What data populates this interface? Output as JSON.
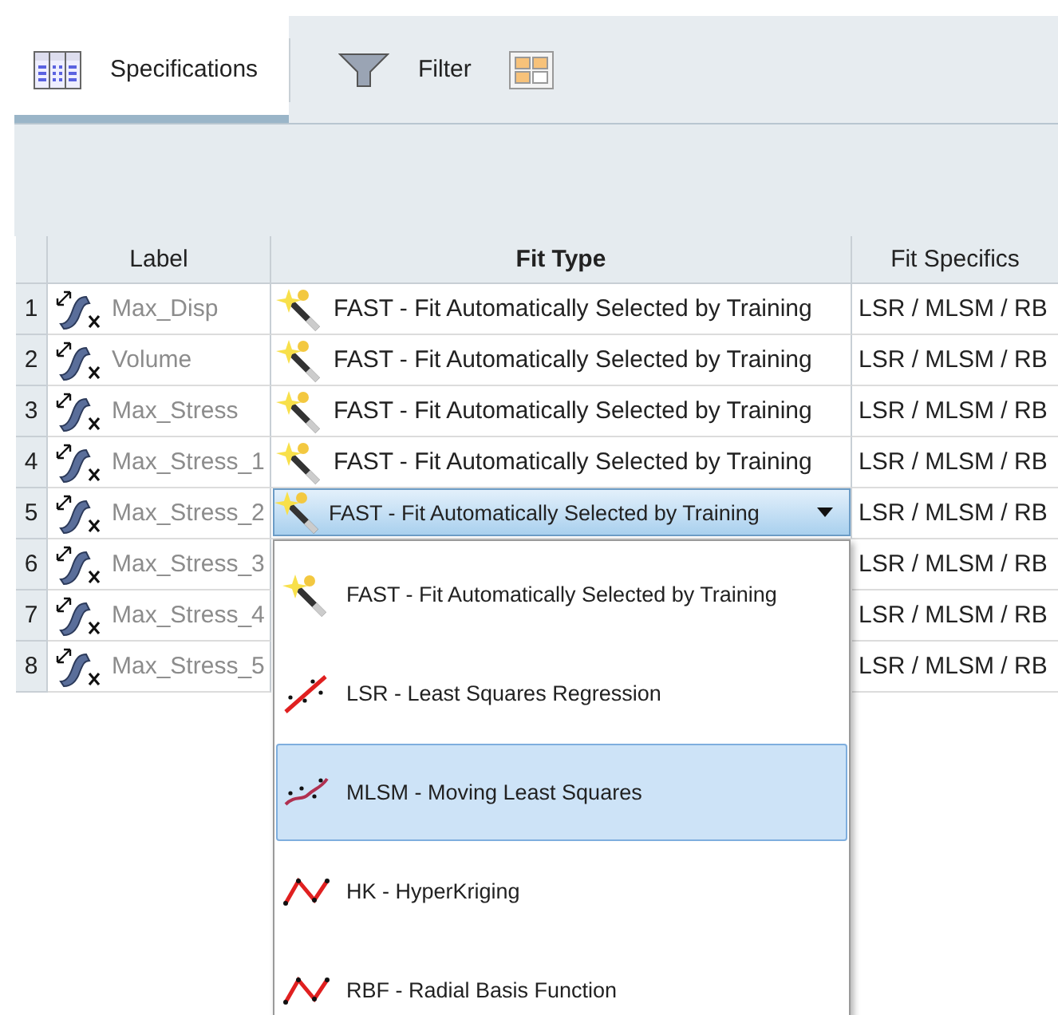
{
  "tabs": [
    {
      "kind": "table",
      "label": "Specifications",
      "selected": true
    },
    {
      "kind": "filter",
      "label": "Filter",
      "selected": false
    }
  ],
  "table": {
    "columns": [
      "Label",
      "Fit Type",
      "Fit Specifics"
    ],
    "rows": [
      {
        "number": "1",
        "label": "Max_Disp",
        "fit_type": "FAST - Fit Automatically Selected by Training",
        "fit_specifics": "LSR / MLSM / RB"
      },
      {
        "number": "2",
        "label": "Volume",
        "fit_type": "FAST - Fit Automatically Selected by Training",
        "fit_specifics": "LSR / MLSM / RB"
      },
      {
        "number": "3",
        "label": "Max_Stress",
        "fit_type": "FAST - Fit Automatically Selected by Training",
        "fit_specifics": "LSR / MLSM / RB"
      },
      {
        "number": "4",
        "label": "Max_Stress_1",
        "fit_type": "FAST - Fit Automatically Selected by Training",
        "fit_specifics": "LSR / MLSM / RB"
      },
      {
        "number": "5",
        "label": "Max_Stress_2",
        "editing": true,
        "fit_type": "FAST - Fit Automatically Selected by Training",
        "fit_specifics": "LSR / MLSM / RB"
      },
      {
        "number": "6",
        "label": "Max_Stress_3",
        "fit_specifics": "LSR / MLSM / RB"
      },
      {
        "number": "7",
        "label": "Max_Stress_4",
        "fit_specifics": "LSR / MLSM / RB"
      },
      {
        "number": "8",
        "label": "Max_Stress_5",
        "fit_specifics": "LSR / MLSM / RB"
      }
    ]
  },
  "dropdown_options": [
    {
      "kind": "wand",
      "label": "FAST - Fit Automatically Selected by Training",
      "selected": false
    },
    {
      "kind": "line",
      "label": "LSR - Least Squares Regression",
      "selected": false
    },
    {
      "kind": "curve",
      "label": "MLSM - Moving Least Squares",
      "selected": true
    },
    {
      "kind": "zigzag",
      "label": "HK - HyperKriging",
      "selected": false
    },
    {
      "kind": "zigzag",
      "label": "RBF - Radial Basis Function",
      "selected": false
    }
  ]
}
